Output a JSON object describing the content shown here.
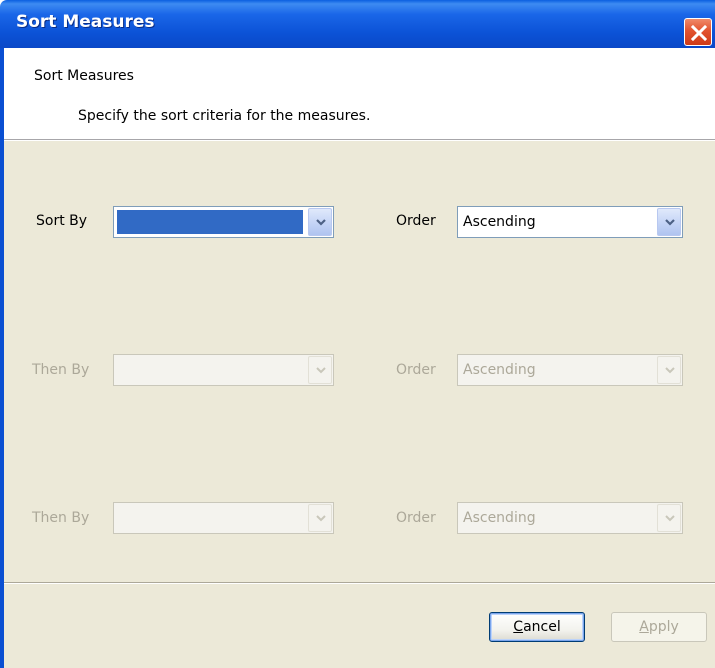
{
  "window": {
    "title": "Sort Measures",
    "close_icon": "close-icon"
  },
  "header": {
    "title": "Sort Measures",
    "description": "Specify the sort criteria for the measures."
  },
  "rows": [
    {
      "label": "Sort By",
      "value": "",
      "order_label": "Order",
      "order_value": "Ascending",
      "enabled": true
    },
    {
      "label": "Then By",
      "value": "",
      "order_label": "Order",
      "order_value": "Ascending",
      "enabled": false
    },
    {
      "label": "Then By",
      "value": "",
      "order_label": "Order",
      "order_value": "Ascending",
      "enabled": false
    }
  ],
  "buttons": {
    "cancel_accel": "C",
    "cancel_rest": "ancel",
    "apply_accel": "A",
    "apply_rest": "pply"
  },
  "colors": {
    "titlebar": "#0b52d6",
    "selection": "#316ac5",
    "panel": "#ece9d8",
    "disabled_text": "#aca899"
  }
}
